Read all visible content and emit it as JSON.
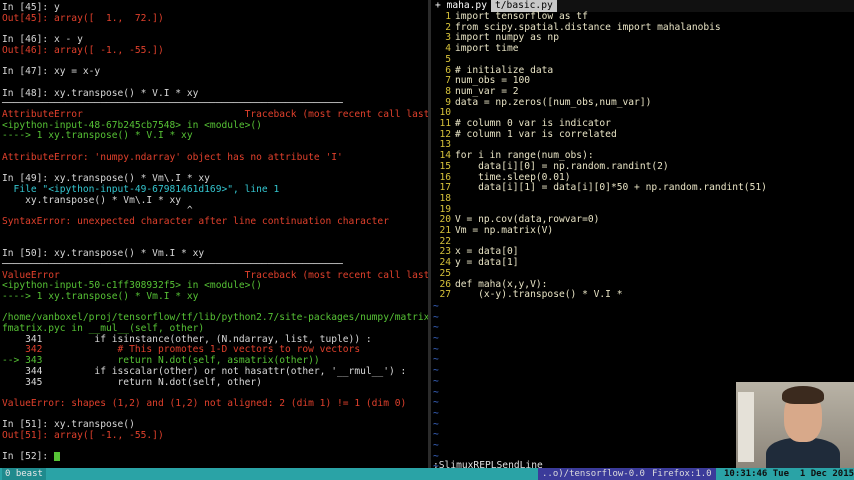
{
  "ipython": {
    "lines": [
      {
        "cls": "w",
        "text": "In [45]: y"
      },
      {
        "cls": "r",
        "text": "Out[45]: array([  1.,  72.])"
      },
      {
        "cls": "w",
        "text": ""
      },
      {
        "cls": "w",
        "text": "In [46]: x - y"
      },
      {
        "cls": "r",
        "text": "Out[46]: array([ -1., -55.])"
      },
      {
        "cls": "w",
        "text": ""
      },
      {
        "cls": "w",
        "text": "In [47]: xy = x-y"
      },
      {
        "cls": "w",
        "text": ""
      },
      {
        "cls": "w",
        "text": "In [48]: xy.transpose() * V.I * xy"
      },
      {
        "cls": "w",
        "text": "───────────────────────────────────────────────────────────"
      },
      {
        "cls": "r",
        "text": "AttributeError                            Traceback (most recent call last)"
      },
      {
        "cls": "g",
        "text": "<ipython-input-48-67b245cb7548> in <module>()"
      },
      {
        "cls": "g",
        "text": "----> 1 xy.transpose() * V.I * xy"
      },
      {
        "cls": "w",
        "text": ""
      },
      {
        "cls": "r",
        "text": "AttributeError: 'numpy.ndarray' object has no attribute 'I'"
      },
      {
        "cls": "w",
        "text": ""
      },
      {
        "cls": "w",
        "text": "In [49]: xy.transpose() * Vm\\.I * xy"
      },
      {
        "cls": "c",
        "text": "  File \"<ipython-input-49-67981461d169>\", line 1"
      },
      {
        "cls": "w",
        "text": "    xy.transpose() * Vm\\.I * xy"
      },
      {
        "cls": "w",
        "text": "                                ^"
      },
      {
        "cls": "r",
        "text": "SyntaxError: unexpected character after line continuation character"
      },
      {
        "cls": "w",
        "text": ""
      },
      {
        "cls": "w",
        "text": ""
      },
      {
        "cls": "w",
        "text": "In [50]: xy.transpose() * Vm.I * xy"
      },
      {
        "cls": "w",
        "text": "───────────────────────────────────────────────────────────"
      },
      {
        "cls": "r",
        "text": "ValueError                                Traceback (most recent call last)"
      },
      {
        "cls": "g",
        "text": "<ipython-input-50-c1ff308932f5> in <module>()"
      },
      {
        "cls": "g",
        "text": "----> 1 xy.transpose() * Vm.I * xy"
      },
      {
        "cls": "w",
        "text": ""
      },
      {
        "cls": "g",
        "text": "/home/vanboxel/proj/tensorflow/tf/lib/python2.7/site-packages/numpy/matrixlib/de"
      },
      {
        "cls": "g",
        "text": "fmatrix.pyc in __mul__(self, other)"
      },
      {
        "cls": "w",
        "text": "    341         if isinstance(other, (N.ndarray, list, tuple)) :"
      },
      {
        "cls": "r",
        "text": "    342             # This promotes 1-D vectors to row vectors"
      },
      {
        "cls": "g",
        "text": "--> 343             return N.dot(self, asmatrix(other))"
      },
      {
        "cls": "w",
        "text": "    344         if isscalar(other) or not hasattr(other, '__rmul__') :"
      },
      {
        "cls": "w",
        "text": "    345             return N.dot(self, other)"
      },
      {
        "cls": "w",
        "text": ""
      },
      {
        "cls": "r",
        "text": "ValueError: shapes (1,2) and (1,2) not aligned: 2 (dim 1) != 1 (dim 0)"
      },
      {
        "cls": "w",
        "text": ""
      },
      {
        "cls": "w",
        "text": "In [51]: xy.transpose()"
      },
      {
        "cls": "r",
        "text": "Out[51]: array([ -1., -55.])"
      },
      {
        "cls": "w",
        "text": ""
      },
      {
        "cls": "w",
        "text": "In [52]: "
      }
    ]
  },
  "vim": {
    "tabs": [
      {
        "label": "+ maha.py ",
        "active": true
      },
      {
        "label": "t/basic.py ",
        "active": false
      }
    ],
    "lines": [
      "import tensorflow as tf",
      "from scipy.spatial.distance import mahalanobis",
      "import numpy as np",
      "import time",
      "",
      "# initialize data",
      "num_obs = 100",
      "num_var = 2",
      "data = np.zeros([num_obs,num_var])",
      "",
      "# column 0 var is indicator",
      "# column 1 var is correlated",
      "",
      "for i in range(num_obs):",
      "    data[i][0] = np.random.randint(2)",
      "    time.sleep(0.01)",
      "    data[i][1] = data[i][0]*50 + np.random.randint(51)",
      "",
      "",
      "V = np.cov(data,rowvar=0)",
      "Vm = np.matrix(V)",
      "",
      "x = data[0]",
      "y = data[1]",
      "",
      "def maha(x,y,V):",
      "    (x-y).transpose() * V.I *"
    ],
    "tilde_count": 17,
    "command_line": ":SlimuxREPLSendLine"
  },
  "status": {
    "session": "0 beast",
    "window": "..o)/tensorflow-0.0",
    "app": "Firefox:1.0",
    "time": "10:31:46 Tue  1 Dec 2015"
  },
  "colors": {
    "status_bg": "#2aa3a6",
    "error": "#e0402c",
    "green": "#56c235",
    "line_number": "#d6c23a"
  }
}
